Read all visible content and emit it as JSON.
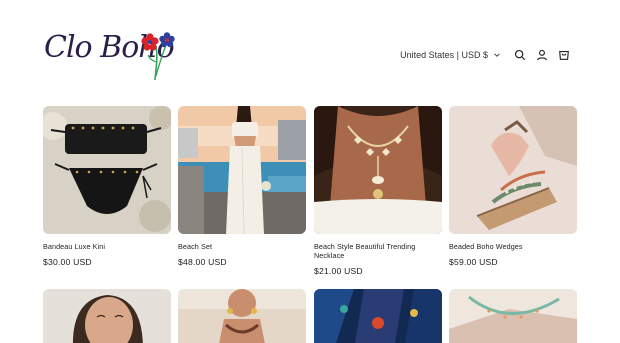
{
  "header": {
    "logo_text": "Clo Boho",
    "country_selector": "United States | USD $",
    "icons": [
      "search-icon",
      "account-icon",
      "cart-icon"
    ]
  },
  "products": [
    {
      "title": "Bandeau Luxe Kini",
      "price": "$30.00 USD"
    },
    {
      "title": "Beach Set",
      "price": "$48.00 USD"
    },
    {
      "title": "Beach Style Beautiful Trending Necklace",
      "price": "$21.00 USD"
    },
    {
      "title": "Beaded Boho Wedges",
      "price": "$59.00 USD"
    }
  ],
  "colors": {
    "logo": "#2a1f4a",
    "flower_red": "#d8232a",
    "flower_blue": "#2b3f9e",
    "stem": "#3aa65a"
  }
}
